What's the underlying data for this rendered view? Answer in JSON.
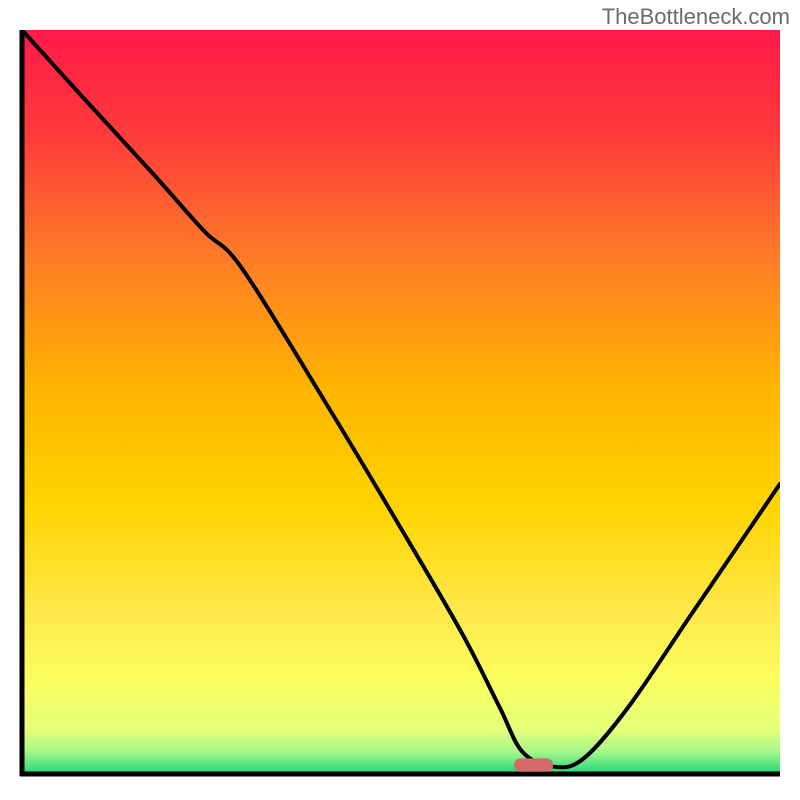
{
  "watermark": "TheBottleneck.com",
  "chart_data": {
    "type": "line",
    "title": "",
    "xlabel": "",
    "ylabel": "",
    "xlim": [
      0,
      100
    ],
    "ylim": [
      0,
      100
    ],
    "note": "No axis tick labels or numeric scales are visible; x/y values below are in percent-of-plot-width/height coordinates (0–100) estimated from the rendered curve.",
    "gradient_background": {
      "top_color": "#ff1a4a",
      "mid_colors": [
        "#ff6a2a",
        "#ffc400",
        "#ffe84a",
        "#f6ff6a"
      ],
      "bottom_band_color": "#1fd67a"
    },
    "marker": {
      "shape": "rounded-rect",
      "color": "#d46a6a",
      "position_x": 67.5,
      "position_y": 1.2,
      "width": 5.2,
      "height": 1.8
    },
    "series": [
      {
        "name": "bottleneck-curve",
        "color": "#000000",
        "x": [
          0,
          8,
          17,
          24,
          29,
          40,
          50,
          58,
          63,
          66,
          70,
          74,
          80,
          88,
          96,
          100
        ],
        "y": [
          100,
          91,
          81,
          73,
          68,
          50,
          33,
          19,
          9,
          3,
          1,
          2,
          9,
          21,
          33,
          39
        ]
      }
    ]
  }
}
